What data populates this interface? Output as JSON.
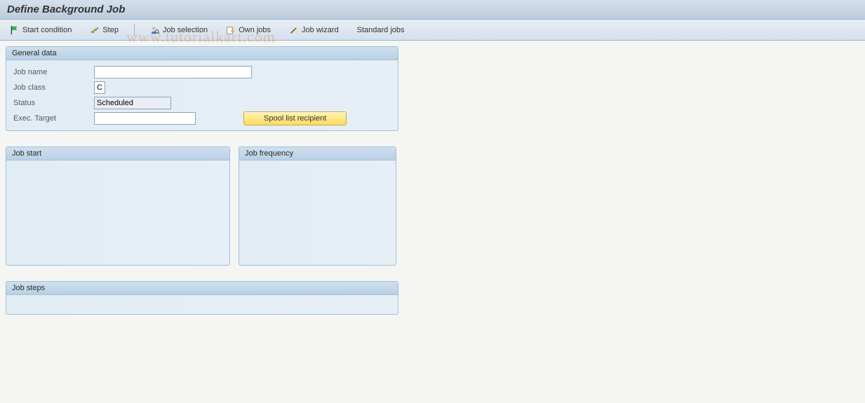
{
  "title": "Define Background Job",
  "toolbar": {
    "start_condition": "Start condition",
    "step": "Step",
    "job_selection": "Job selection",
    "own_jobs": "Own jobs",
    "job_wizard": "Job wizard",
    "standard_jobs": "Standard jobs"
  },
  "general_data": {
    "header": "General data",
    "job_name_label": "Job name",
    "job_name_value": "",
    "job_class_label": "Job class",
    "job_class_value": "C",
    "status_label": "Status",
    "status_value": "Scheduled",
    "exec_target_label": "Exec. Target",
    "exec_target_value": "",
    "spool_button": "Spool list recipient"
  },
  "job_start": {
    "header": "Job start"
  },
  "job_frequency": {
    "header": "Job frequency"
  },
  "job_steps": {
    "header": "Job steps"
  },
  "watermark": "www.tutorialkart.com"
}
